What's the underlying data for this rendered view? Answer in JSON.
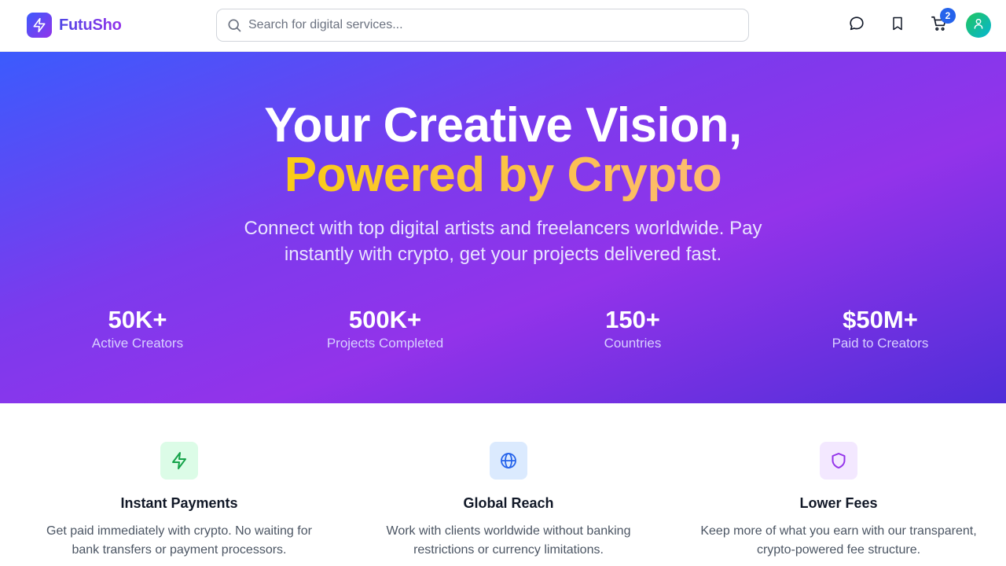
{
  "header": {
    "brand": "FutuSho",
    "search_placeholder": "Search for digital services...",
    "cart_count": "2",
    "icons": [
      "lightning-bolt-icon",
      "search-icon",
      "message-icon",
      "bookmark-icon",
      "cart-icon",
      "user-icon"
    ]
  },
  "hero": {
    "title_line1": "Your Creative Vision,",
    "title_line2": "Powered by Crypto",
    "subtitle_line1": "Connect with top digital artists and freelancers worldwide. Pay",
    "subtitle_line2": "instantly with crypto, get your projects delivered fast.",
    "stats": [
      {
        "value": "50K+",
        "label": "Active Creators"
      },
      {
        "value": "500K+",
        "label": "Projects Completed"
      },
      {
        "value": "150+",
        "label": "Countries"
      },
      {
        "value": "$50M+",
        "label": "Paid to Creators"
      }
    ]
  },
  "features": [
    {
      "title": "Instant Payments",
      "desc_line1": "Get paid immediately with crypto. No waiting for",
      "desc_line2": "bank transfers or payment processors.",
      "icon": "lightning-icon",
      "icon_bg": "#dcfce7",
      "icon_color": "#16a34a"
    },
    {
      "title": "Global Reach",
      "desc_line1": "Work with clients worldwide without banking",
      "desc_line2": "restrictions or currency limitations.",
      "icon": "globe-icon",
      "icon_bg": "#dbeafe",
      "icon_color": "#2563eb"
    },
    {
      "title": "Lower Fees",
      "desc_line1": "Keep more of what you earn with our transparent,",
      "desc_line2": "crypto-powered fee structure.",
      "icon": "shield-icon",
      "icon_bg": "#f3e8ff",
      "icon_color": "#9333ea"
    }
  ],
  "colors": {
    "brand_gradient_start": "#3b5bfd",
    "brand_gradient_end": "#9333ea",
    "highlight_gradient_start": "#facc15",
    "highlight_gradient_end": "#fdba74",
    "badge": "#2563eb"
  }
}
